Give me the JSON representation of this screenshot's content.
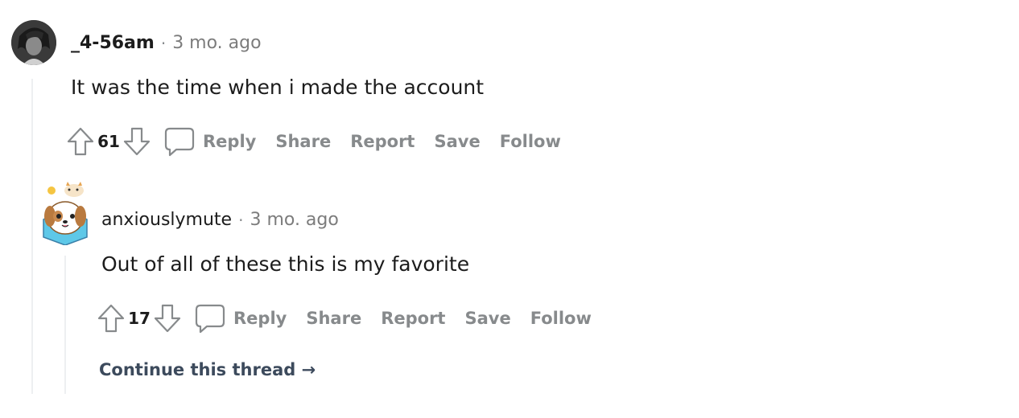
{
  "comment": {
    "author": "_4-56am",
    "separator": "·",
    "time_ago": "3 mo. ago",
    "body": "It was the time when i made the account",
    "score": "61",
    "actions": {
      "reply": "Reply",
      "share": "Share",
      "report": "Report",
      "save": "Save",
      "follow": "Follow"
    }
  },
  "reply": {
    "author": "anxiouslymute",
    "separator": "·",
    "time_ago": "3 mo. ago",
    "body": "Out of all of these this is my favorite",
    "score": "17",
    "actions": {
      "reply": "Reply",
      "share": "Share",
      "report": "Report",
      "save": "Save",
      "follow": "Follow"
    }
  },
  "continue_thread": "Continue this thread →",
  "icons": {
    "upvote": "upvote-arrow-icon",
    "downvote": "downvote-arrow-icon",
    "comment": "comment-bubble-icon"
  },
  "colors": {
    "text_primary": "#1c1c1c",
    "text_muted": "#878a8c",
    "thread_line": "#edeff1",
    "continue_link": "#3c4a5c"
  }
}
